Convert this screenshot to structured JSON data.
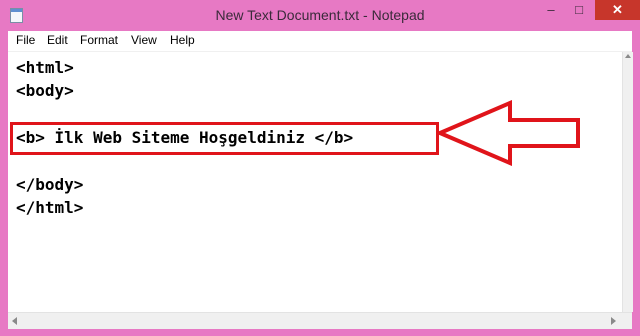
{
  "window": {
    "title": "New Text Document.txt - Notepad",
    "controls": {
      "minimize": "–",
      "maximize": "□",
      "close": "✕"
    }
  },
  "menubar": {
    "items": [
      "File",
      "Edit",
      "Format",
      "View",
      "Help"
    ]
  },
  "editor": {
    "lines": [
      "<html>",
      "<body>",
      "",
      "<b> İlk Web Siteme Hoşgeldiniz </b>",
      "",
      "</body>",
      "</html>"
    ]
  },
  "annotation": {
    "color": "#e0141a"
  },
  "colors": {
    "titlebar": "#e779c4",
    "close_button": "#c7362b"
  }
}
